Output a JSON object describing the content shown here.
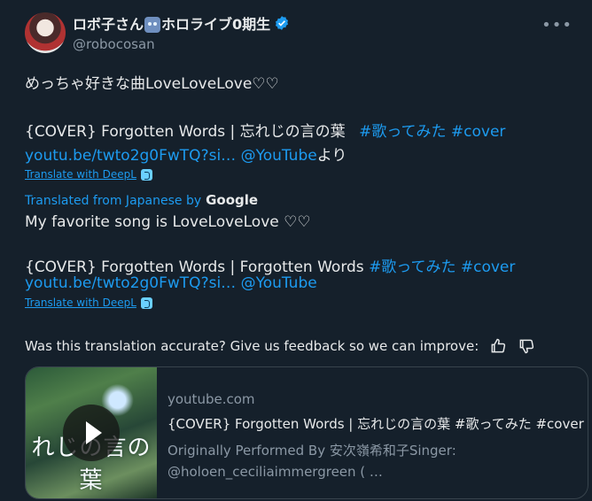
{
  "author": {
    "display_name_part1": "ロボ子さん",
    "display_name_part2": "ホロライブ0期生",
    "emoji": "robot-face",
    "handle": "@robocosan"
  },
  "tweet": {
    "line1": "めっちゃ好きな曲LoveLoveLove♡♡",
    "line2_text": "{COVER} Forgotten Words | 忘れじの言の葉 ",
    "line2_hashtag1": "#歌ってみた",
    "line2_hashtag2": "#cover",
    "line3_link": "youtu.be/twto2g0FwTQ?si…",
    "line3_mention": "@YouTube",
    "line3_suffix": "より",
    "deepl_label": "Translate with DeepL"
  },
  "translation": {
    "from_label": "Translated from Japanese by",
    "provider": "Google",
    "line1": "My favorite song is LoveLoveLove ♡♡",
    "line2_text": "{COVER} Forgotten Words | Forgotten Words ",
    "line2_hashtag1": "#歌ってみた",
    "line2_hashtag2": "#cover",
    "line3_link": "youtu.be/twto2g0FwTQ?si…",
    "line3_mention": "@YouTube",
    "deepl_label": "Translate with DeepL"
  },
  "feedback": {
    "question": "Was this translation accurate? Give us feedback so we can improve:"
  },
  "card": {
    "domain": "youtube.com",
    "title": "{COVER} Forgotten Words | 忘れじの言の葉 #歌ってみた #cover",
    "description_line1": "Originally Performed By 安次嶺希和子Singer:",
    "description_line2": "@holoen_ceciliaimmergreen ( …",
    "thumbnail_text": "れじの言の葉"
  },
  "colors": {
    "background": "#15202b",
    "link": "#1d9bf0",
    "text": "#e7e9ea",
    "muted": "#8b98a5"
  }
}
